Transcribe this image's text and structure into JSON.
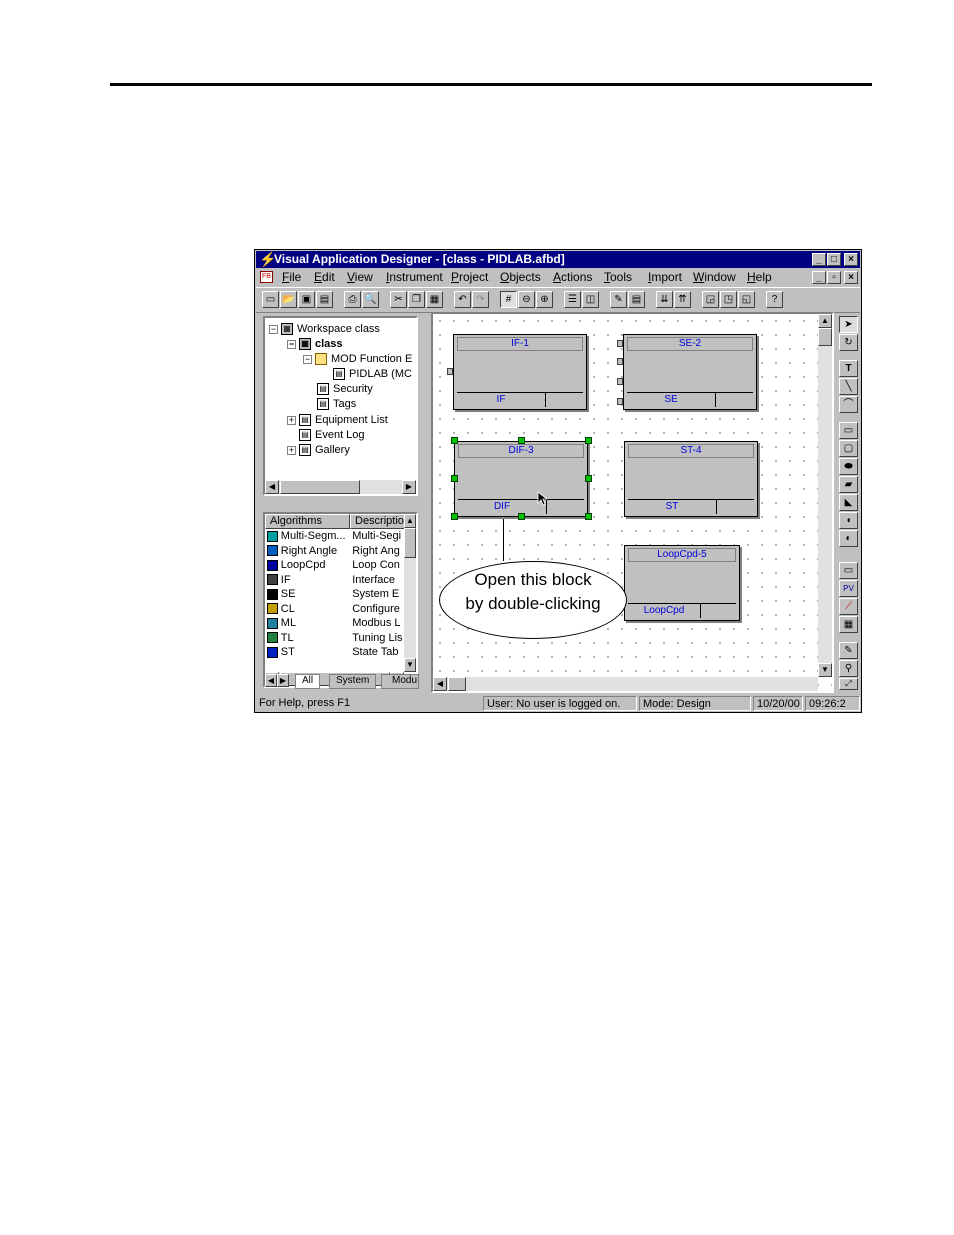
{
  "window": {
    "title": "Visual Application Designer - [class - PIDLAB.afbd]",
    "caption_buttons": [
      "_",
      "□",
      "×"
    ],
    "mdi_buttons": [
      "_",
      "▫",
      "×"
    ]
  },
  "menu": [
    "File",
    "Edit",
    "View",
    "Instrument",
    "Project",
    "Objects",
    "Actions",
    "Tools",
    "Import",
    "Window",
    "Help"
  ],
  "toolbar": {
    "buttons": [
      "new-icon",
      "open-icon",
      "save-icon",
      "save-all-icon",
      "print-icon",
      "print-preview-icon",
      "cut-icon",
      "copy-icon",
      "paste-icon",
      "undo-icon",
      "redo-icon",
      "grid-icon",
      "zoom-out-icon",
      "zoom-in-icon",
      "tile-horizontal-icon",
      "tile-vertical-icon",
      "compile-icon",
      "properties-icon",
      "download-icon",
      "upload-icon",
      "window-1-icon",
      "window-2-icon",
      "window-3-icon",
      "context-help-icon"
    ]
  },
  "tree": {
    "items": [
      {
        "label": "Workspace class",
        "expander": "−"
      },
      {
        "label": "class",
        "expander": "−"
      },
      {
        "label": "MOD Function E",
        "expander": "−"
      },
      {
        "label": "PIDLAB (MC",
        "expander": ""
      },
      {
        "label": "Security",
        "expander": ""
      },
      {
        "label": "Tags",
        "expander": ""
      },
      {
        "label": "Equipment List",
        "expander": "+"
      },
      {
        "label": "Event Log",
        "expander": ""
      },
      {
        "label": "Gallery",
        "expander": "+"
      }
    ]
  },
  "algorithms": {
    "headers": [
      "Algorithms",
      "Descriptio"
    ],
    "rows": [
      {
        "name": "Multi-Segm...",
        "desc": "Multi-Segi",
        "color": "#00a0a0"
      },
      {
        "name": "Right Angle",
        "desc": "Right Ang",
        "color": "#0060c0"
      },
      {
        "name": "LoopCpd",
        "desc": "Loop Con",
        "color": "#0000a0"
      },
      {
        "name": "IF",
        "desc": "Interface",
        "color": "#404040"
      },
      {
        "name": "SE",
        "desc": "System E",
        "color": "#000000"
      },
      {
        "name": "CL",
        "desc": "Configure",
        "color": "#c0a000"
      },
      {
        "name": "ML",
        "desc": "Modbus L",
        "color": "#2080a0"
      },
      {
        "name": "TL",
        "desc": "Tuning Lis",
        "color": "#208040"
      },
      {
        "name": "ST",
        "desc": "State Tab",
        "color": "#0020c0"
      }
    ],
    "tabs": [
      "All",
      "System",
      "Modu"
    ]
  },
  "blocks": [
    {
      "title": "IF-1",
      "type": "IF"
    },
    {
      "title": "SE-2",
      "type": "SE"
    },
    {
      "title": "DIF-3",
      "type": "DIF"
    },
    {
      "title": "ST-4",
      "type": "ST"
    },
    {
      "title": "LoopCpd-5",
      "type": "LoopCpd"
    }
  ],
  "callout": {
    "line1": "Open this block",
    "line2": "by double-clicking"
  },
  "palette": [
    "pointer-icon",
    "rotate-icon",
    "text-icon",
    "line-icon",
    "arc-icon",
    "rectangle-icon",
    "rounded-rect-icon",
    "ellipse-icon",
    "polygon-icon",
    "pie-icon",
    "chord-icon",
    "circle-icon",
    "frame-icon",
    "pv-icon",
    "trend-icon",
    "bitmap-icon",
    "dropper-icon",
    "zoom-icon",
    "zoom-fit-icon"
  ],
  "status": {
    "help": "For Help, press F1",
    "user": "User:  No user is logged on.",
    "mode": "Mode:  Design",
    "date": "10/20/00",
    "time": "09:26:2"
  }
}
